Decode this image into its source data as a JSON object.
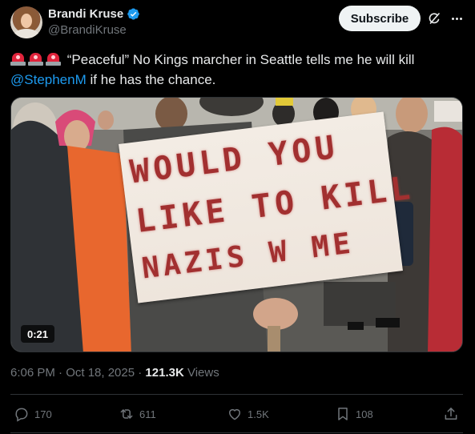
{
  "author": {
    "name": "Brandi Kruse",
    "handle": "@BrandiKruse",
    "verified": true
  },
  "header_actions": {
    "subscribe_label": "Subscribe",
    "grok_icon": "grok-icon",
    "more_icon": "more-icon"
  },
  "tweet": {
    "emoji": [
      "rotating-light",
      "rotating-light",
      "rotating-light"
    ],
    "text_before_mention": "“Peaceful” No Kings marcher in Seattle tells me he will kill",
    "mention": "@StephenM",
    "text_after_mention": " if he has the chance."
  },
  "media": {
    "sign_line_1": "WOULD YOU",
    "sign_line_2": "LIKE TO KILL",
    "sign_line_3": "NAZIS W ME",
    "duration": "0:21"
  },
  "meta": {
    "timestamp": "6:06 PM · Oct 18, 2025 · ",
    "views_count": "121.3K",
    "views_label": " Views"
  },
  "actions": {
    "replies": "170",
    "reposts": "611",
    "likes": "1.5K",
    "bookmarks": "108"
  },
  "colors": {
    "background": "#000000",
    "text": "#e7e9ea",
    "secondary": "#71767b",
    "accent": "#1d9bf0",
    "sign_ink": "#a23030"
  }
}
